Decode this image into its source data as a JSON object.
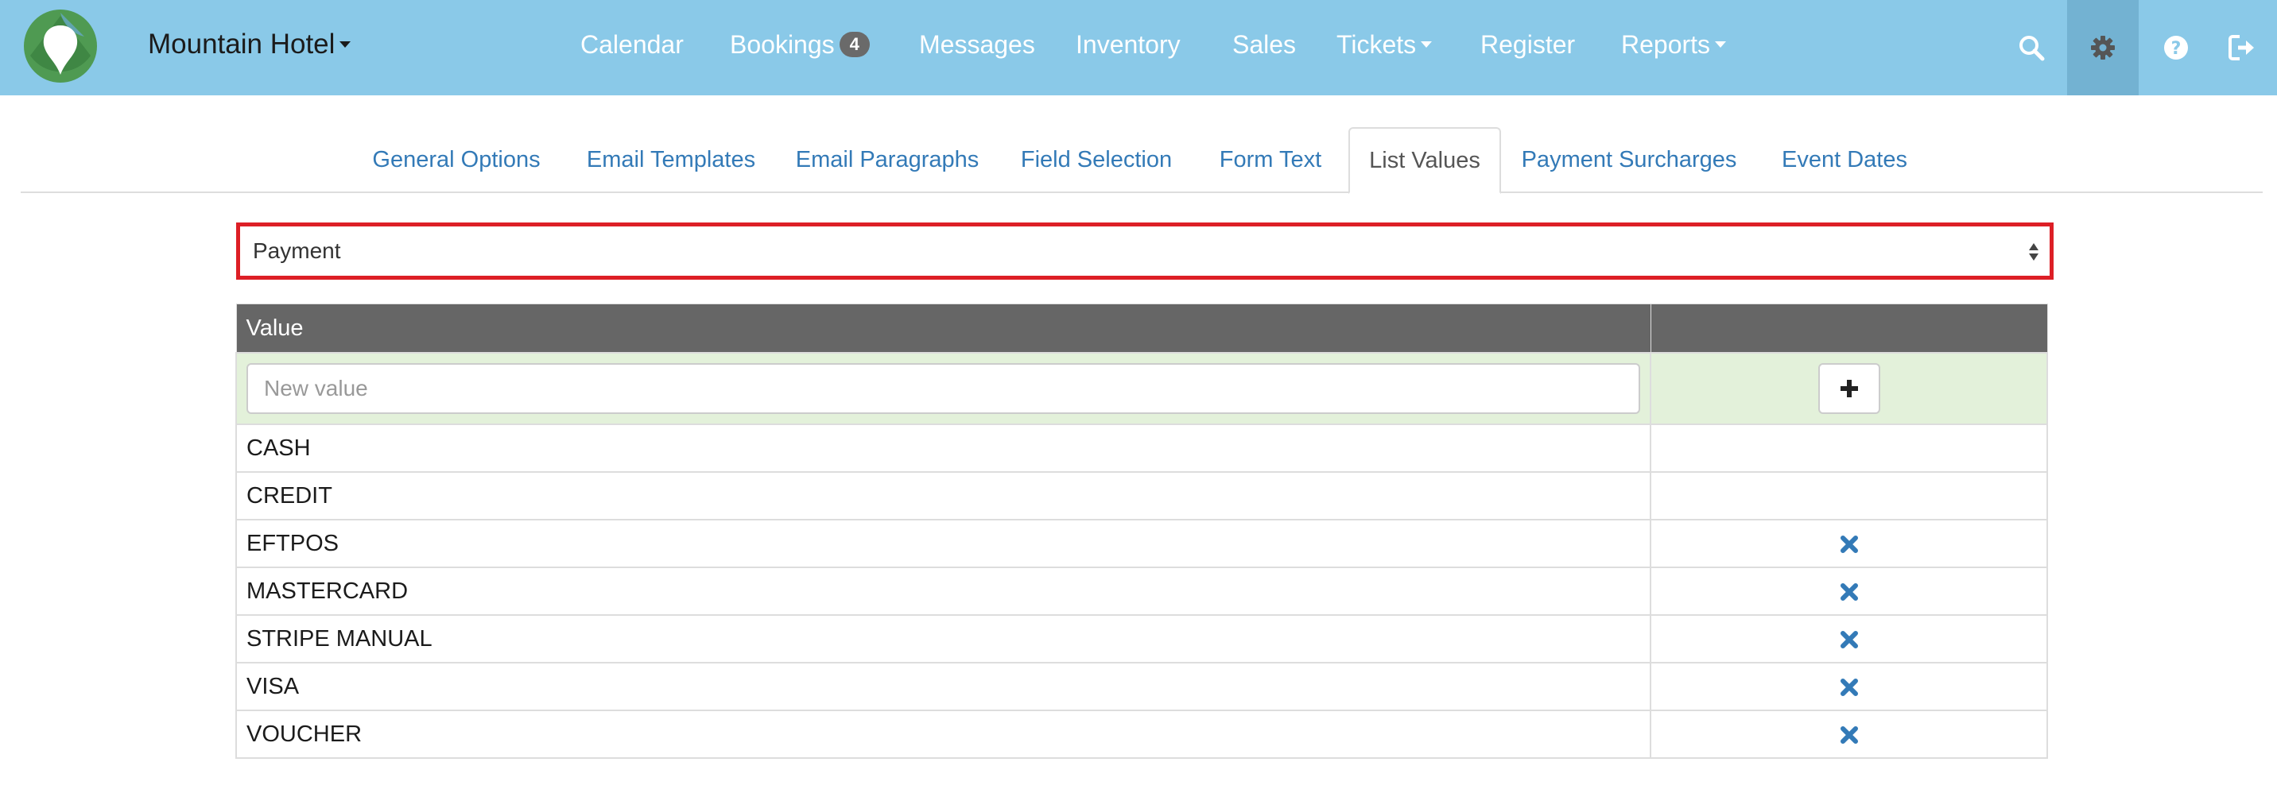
{
  "app": {
    "hotel_name": "Mountain Hotel"
  },
  "nav": {
    "items": [
      {
        "label": "Calendar"
      },
      {
        "label": "Bookings",
        "badge": "4"
      },
      {
        "label": "Messages"
      },
      {
        "label": "Inventory"
      },
      {
        "label": "Sales"
      },
      {
        "label": "Tickets"
      },
      {
        "label": "Register"
      },
      {
        "label": "Reports"
      }
    ],
    "icons": [
      "search-icon",
      "gear-icon",
      "question-circle-icon",
      "logout-icon"
    ]
  },
  "tabs": [
    {
      "label": "General Options"
    },
    {
      "label": "Email Templates"
    },
    {
      "label": "Email Paragraphs"
    },
    {
      "label": "Field Selection"
    },
    {
      "label": "Form Text"
    },
    {
      "label": "List Values",
      "active": true
    },
    {
      "label": "Payment Surcharges"
    },
    {
      "label": "Event Dates"
    }
  ],
  "list_select": {
    "selected": "Payment"
  },
  "table": {
    "header": {
      "value": "Value",
      "action": ""
    },
    "new_value_placeholder": "New value",
    "add_icon": "plus-icon",
    "rows": [
      {
        "value": "CASH",
        "deletable": false
      },
      {
        "value": "CREDIT",
        "deletable": false
      },
      {
        "value": "EFTPOS",
        "deletable": true
      },
      {
        "value": "MASTERCARD",
        "deletable": true
      },
      {
        "value": "STRIPE MANUAL",
        "deletable": true
      },
      {
        "value": "VISA",
        "deletable": true
      },
      {
        "value": "VOUCHER",
        "deletable": true
      }
    ],
    "delete_icon": "times-icon"
  },
  "colors": {
    "navbar": "#8ac9e8",
    "link": "#337ab7",
    "table_header": "#666666",
    "new_row": "#e3f1da",
    "highlight_border": "#dd1f26"
  }
}
